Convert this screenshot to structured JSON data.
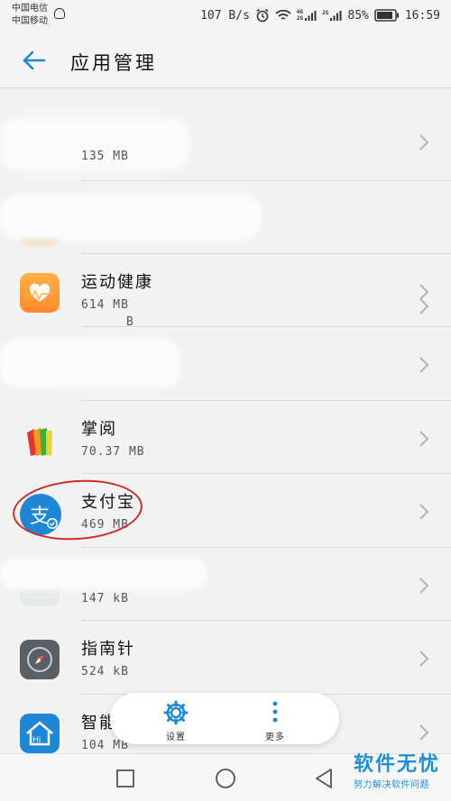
{
  "status_bar": {
    "carrier_1": "中国电信",
    "carrier_2": "中国移动",
    "network_speed": "107 B/s",
    "battery": "85%",
    "time": "16:59",
    "sig_4g_top": "4G",
    "sig_4g_bottom": "2G",
    "sig_2g": "2G"
  },
  "header": {
    "title": "应用管理"
  },
  "apps": [
    {
      "name": "",
      "size": "135 MB"
    },
    {
      "name": "",
      "size": "B"
    },
    {
      "name": "运动健康",
      "size": "614 MB"
    },
    {
      "name": "",
      "size": ""
    },
    {
      "name": "掌阅",
      "size": "70.37 MB"
    },
    {
      "name": "支付宝",
      "size": "469 MB"
    },
    {
      "name": "",
      "size": "147 kB"
    },
    {
      "name": "指南针",
      "size": "524 kB"
    },
    {
      "name": "智能家居",
      "size": "104 MB"
    }
  ],
  "floating_menu": {
    "settings_label": "设置",
    "more_label": "更多"
  },
  "watermark": {
    "brand": "软件无忧",
    "tagline": "努力解决软件问题"
  },
  "colors": {
    "accent": "#1e88d6",
    "highlight_circle": "#d02a2a"
  }
}
